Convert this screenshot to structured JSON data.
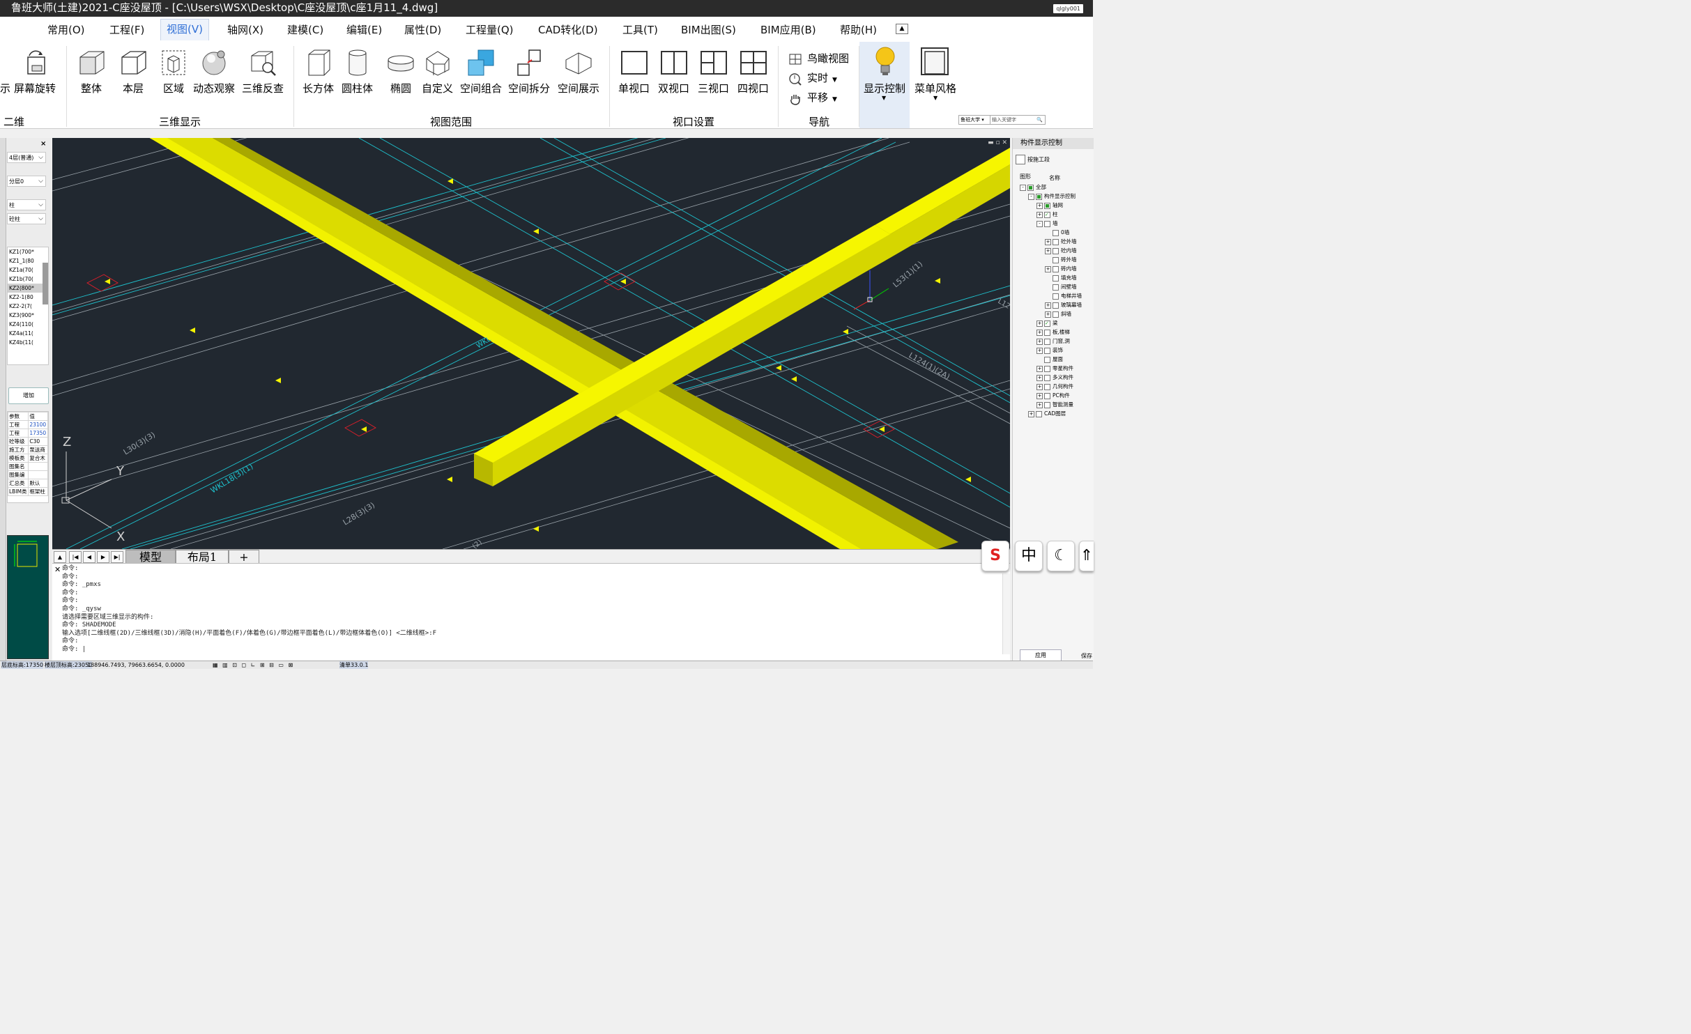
{
  "title_bar": {
    "title": "鲁班大师(土建)2021-C座没屋顶 - [C:\\Users\\WSX\\Desktop\\C座没屋顶\\c座1月11_4.dwg]",
    "account": "qlgly001"
  },
  "menu": [
    "常用(O)",
    "工程(F)",
    "视图(V)",
    "轴网(X)",
    "建模(C)",
    "编辑(E)",
    "属性(D)",
    "工程量(Q)",
    "CAD转化(D)",
    "工具(T)",
    "BIM出图(S)",
    "BIM应用(B)",
    "帮助(H)"
  ],
  "ribbon": {
    "groups": [
      "二维",
      "三维显示",
      "视图范围",
      "视口设置",
      "导航"
    ],
    "partial_left": "示",
    "btn_rotate": "屏幕旋转",
    "three_d": [
      "整体",
      "本层",
      "区域",
      "动态观察",
      "三维反查"
    ],
    "range": [
      "长方体",
      "圆柱体",
      "椭圆",
      "自定义",
      "空间组合",
      "空间拆分",
      "空间展示"
    ],
    "viewports": [
      "单视口",
      "双视口",
      "三视口",
      "四视口"
    ],
    "nav": [
      "鸟瞰视图",
      "实时",
      "平移"
    ],
    "display_control": "显示控制",
    "menu_style": "菜单风格",
    "search_scope": "鲁班大学",
    "search_placeholder": "输入关键字"
  },
  "left_panel": {
    "floor": "4层(普通)",
    "layer": "分层0",
    "category": "柱",
    "type": "砼柱",
    "items": [
      "KZ1(700*",
      "KZ1_1(80",
      "KZ1a(70(",
      "KZ1b(70(",
      "KZ2(800*",
      "KZ2-1(80",
      "KZ2-2(7(",
      "KZ3(900*",
      "KZ4(110(",
      "KZ4a(11(",
      "KZ4b(11("
    ],
    "selected_index": 4,
    "add": "增加",
    "props_header": [
      "参数",
      "值"
    ],
    "props": [
      [
        "工程",
        "23100"
      ],
      [
        "工程",
        "17350"
      ],
      [
        "砼等级",
        "C30"
      ],
      [
        "施工方",
        "泵送商"
      ],
      [
        "模板类",
        "复合木"
      ],
      [
        "图集名",
        ""
      ],
      [
        "图集编",
        ""
      ],
      [
        "汇总类",
        "默认"
      ],
      [
        "LBIM类",
        "框架柱"
      ]
    ]
  },
  "viewport": {
    "axis": {
      "z": "Z",
      "y": "Y",
      "x": "X"
    },
    "labels": [
      "WKL18(3)(1)",
      "L30(3)(3)",
      "L28(3)(3)",
      "L53(1)(1)",
      "L124(1)(2A)",
      "WKL",
      "L12",
      "(2)"
    ]
  },
  "tabs": [
    "模型",
    "布局1",
    "+"
  ],
  "command_lines": [
    "命令:",
    "命令:",
    "命令: _pmxs",
    "命令:",
    "命令:",
    "命令: _qysw",
    "请选择需要区域三维显示的构件:",
    "命令: SHADEMODE",
    "输入选项[二维线框(2D)/三维线框(3D)/消隐(H)/平面着色(F)/体着色(G)/带边框平面着色(L)/带边框体着色(O)] <二维线框>:F",
    "命令:",
    "",
    "命令: |"
  ],
  "status": {
    "floor_bottom": "层底标高:17350",
    "floor_top": "楼层顶标高:23050",
    "coords": "138946.7493, 79663.6654, 0.0000",
    "version": "清单33.0.1"
  },
  "right_panel": {
    "title": "构件显示控制",
    "by_segment": "按施工段",
    "tabs": [
      "图形",
      "名称"
    ],
    "tree": [
      {
        "l": 0,
        "pm": "-",
        "cb": "on",
        "t": "全部"
      },
      {
        "l": 1,
        "pm": "-",
        "cb": "on",
        "t": "构件显示控制"
      },
      {
        "l": 2,
        "pm": "+",
        "cb": "on",
        "t": "轴网"
      },
      {
        "l": 2,
        "pm": "+",
        "cb": "chk",
        "t": "柱"
      },
      {
        "l": 2,
        "pm": "-",
        "cb": "",
        "t": "墙"
      },
      {
        "l": 3,
        "pm": "",
        "cb": "",
        "t": "0墙"
      },
      {
        "l": 3,
        "pm": "+",
        "cb": "",
        "t": "砼外墙"
      },
      {
        "l": 3,
        "pm": "+",
        "cb": "",
        "t": "砼内墙"
      },
      {
        "l": 3,
        "pm": "",
        "cb": "",
        "t": "砖外墙"
      },
      {
        "l": 3,
        "pm": "+",
        "cb": "",
        "t": "砖内墙"
      },
      {
        "l": 3,
        "pm": "",
        "cb": "",
        "t": "填充墙"
      },
      {
        "l": 3,
        "pm": "",
        "cb": "",
        "t": "间壁墙"
      },
      {
        "l": 3,
        "pm": "",
        "cb": "",
        "t": "电梯井墙"
      },
      {
        "l": 3,
        "pm": "+",
        "cb": "",
        "t": "玻璃幕墙"
      },
      {
        "l": 3,
        "pm": "+",
        "cb": "",
        "t": "斜墙"
      },
      {
        "l": 2,
        "pm": "+",
        "cb": "chk",
        "t": "梁"
      },
      {
        "l": 2,
        "pm": "+",
        "cb": "",
        "t": "板,楼梯"
      },
      {
        "l": 2,
        "pm": "+",
        "cb": "",
        "t": "门窗,洞"
      },
      {
        "l": 2,
        "pm": "+",
        "cb": "",
        "t": "装饰"
      },
      {
        "l": 2,
        "pm": "",
        "cb": "",
        "t": "屋面"
      },
      {
        "l": 2,
        "pm": "+",
        "cb": "",
        "t": "零星构件"
      },
      {
        "l": 2,
        "pm": "+",
        "cb": "",
        "t": "多义构件"
      },
      {
        "l": 2,
        "pm": "+",
        "cb": "",
        "t": "几何构件"
      },
      {
        "l": 2,
        "pm": "+",
        "cb": "",
        "t": "PC构件"
      },
      {
        "l": 2,
        "pm": "+",
        "cb": "",
        "t": "智能测量"
      },
      {
        "l": 1,
        "pm": "+",
        "cb": "",
        "t": "CAD图层"
      }
    ],
    "apply": "应用",
    "save": "保存"
  },
  "ime": [
    "S",
    "中",
    "☾",
    "⇑"
  ]
}
